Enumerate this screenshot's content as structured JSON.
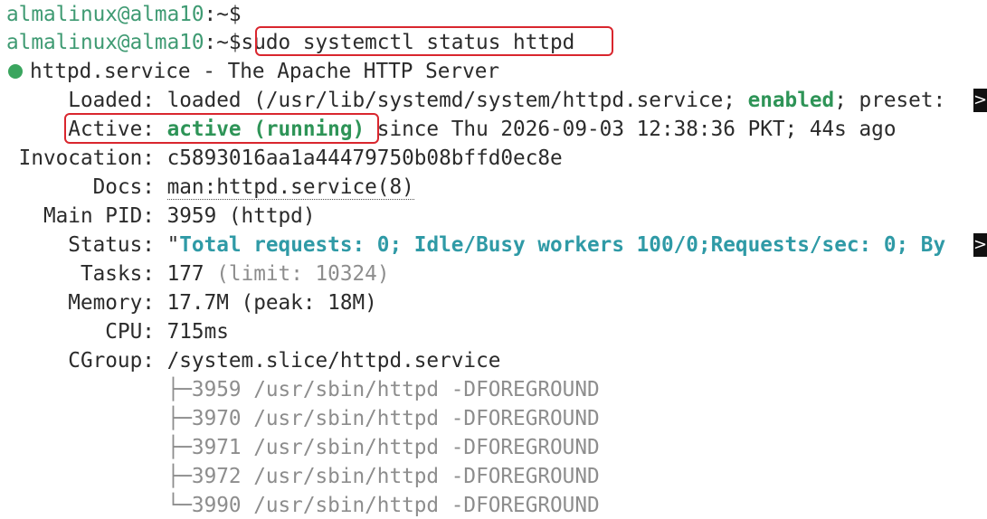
{
  "prompt": {
    "user_host": "almalinux@alma10",
    "sep": ":~$"
  },
  "command": "sudo systemctl status httpd",
  "service": {
    "name": "httpd.service",
    "dash": " - ",
    "description": "The Apache HTTP Server",
    "loaded": {
      "label": "Loaded:",
      "value_pre": "loaded (/usr/lib/systemd/system/httpd.service; ",
      "enabled": "enabled",
      "value_post": "; preset:"
    },
    "active": {
      "label": "Active:",
      "state": "active (running)",
      "since": " since Thu 2026-09-03 12:38:36 PKT; 44s ago"
    },
    "invocation": {
      "label": "Invocation:",
      "value": "c5893016aa1a44479750b08bffd0ec8e"
    },
    "docs": {
      "label": "Docs:",
      "value": "man:httpd.service(8)"
    },
    "main_pid": {
      "label": "Main PID:",
      "value": "3959 (httpd)"
    },
    "status": {
      "label": "Status:",
      "quote": "\"",
      "value": "Total requests: 0; Idle/Busy workers 100/0;Requests/sec: 0; By"
    },
    "tasks": {
      "label": "Tasks:",
      "value": "177",
      "limit": " (limit: 10324)"
    },
    "memory": {
      "label": "Memory:",
      "value": "17.7M (peak: 18M)"
    },
    "cpu": {
      "label": "CPU:",
      "value": "715ms"
    },
    "cgroup": {
      "label": "CGroup:",
      "value": "/system.slice/httpd.service"
    },
    "processes": [
      {
        "branch": "├─",
        "text": "3959 /usr/sbin/httpd -DFOREGROUND"
      },
      {
        "branch": "├─",
        "text": "3970 /usr/sbin/httpd -DFOREGROUND"
      },
      {
        "branch": "├─",
        "text": "3971 /usr/sbin/httpd -DFOREGROUND"
      },
      {
        "branch": "├─",
        "text": "3972 /usr/sbin/httpd -DFOREGROUND"
      },
      {
        "branch": "└─",
        "text": "3990 /usr/sbin/httpd -DFOREGROUND"
      }
    ]
  },
  "truncation_glyph": ">",
  "colors": {
    "prompt": "#3e9a72",
    "enabled": "#2e9457",
    "status_text": "#2f9aa6",
    "highlight_box": "#d9262e"
  }
}
